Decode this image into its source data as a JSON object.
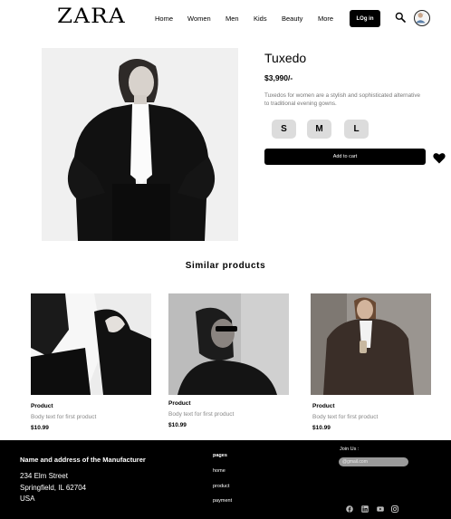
{
  "header": {
    "logo": "ZARA",
    "nav": [
      "Home",
      "Women",
      "Men",
      "Kids",
      "Beauty",
      "More"
    ],
    "login_label": "LOg in"
  },
  "product": {
    "title": "Tuxedo",
    "price": "$3,990/-",
    "description": "Tuxedos for women are a stylish and sophisticated alternative to traditional evening gowns.",
    "sizes": [
      "S",
      "M",
      "L"
    ],
    "cart_label": "Add to cart"
  },
  "similar": {
    "heading": "Similar products",
    "items": [
      {
        "name": "Product",
        "body": "Body text for first product",
        "price": "$10.99"
      },
      {
        "name": "Product",
        "body": "Body text for first product",
        "price": "$10.99"
      },
      {
        "name": "Product",
        "body": "Body text for first product",
        "price": "$10.99"
      }
    ]
  },
  "footer": {
    "heading": "Name and address of the Manufacturer",
    "address": [
      "234 Elm Street",
      "Springfield, IL 62704",
      "USA"
    ],
    "pages_heading": "pages",
    "links": [
      "home",
      "product",
      "payment"
    ],
    "join_label": "Join Us :",
    "email_placeholder": "@gmail.com",
    "social_icons": [
      "facebook-icon",
      "linkedin-icon",
      "youtube-icon",
      "instagram-icon"
    ]
  }
}
